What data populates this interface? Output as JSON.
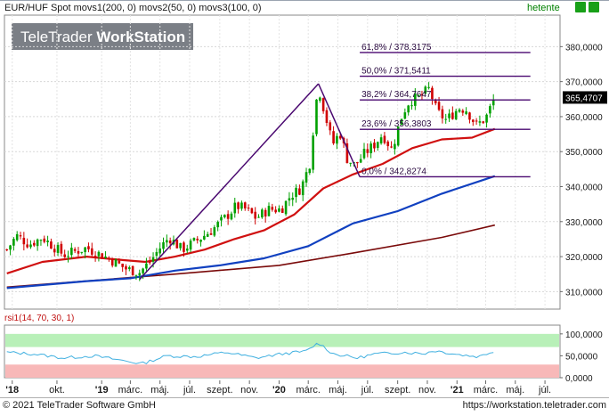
{
  "header": {
    "title": "EUR/HUF Spot movs1(200, 0) movs2(50, 0) movs3(100, 0)",
    "period": "hetente",
    "logo_light": "TeleTrader",
    "logo_bold": "WorkStation"
  },
  "footer": {
    "copyright": "© 2021 TeleTrader Software GmbH",
    "url": "https://workstation.teletrader.com"
  },
  "indicator": {
    "label": "rsi1(14, 70, 30, 1)"
  },
  "colors": {
    "price_up": "#00a000",
    "price_down": "#d00000",
    "ma200": "#7a0a0a",
    "ma50": "#d01010",
    "ma100": "#1040c0",
    "trendline": "#4a0870",
    "fib_line": "#4a0870",
    "rsi_line": "#40b0e0",
    "rsi_overbought_zone": "#b8f0b8",
    "rsi_oversold_zone": "#f8b8b8"
  },
  "chart_data": [
    {
      "type": "line",
      "title": "EUR/HUF Spot movs1(200, 0) movs2(50, 0) movs3(100, 0)",
      "frequency": "hetente",
      "ylim": [
        305000,
        389000
      ],
      "y_ticks": [
        310000,
        320000,
        330000,
        340000,
        350000,
        360000,
        370000,
        380000
      ],
      "y_tick_labels": [
        "310,0000",
        "320,0000",
        "330,0000",
        "340,0000",
        "350,0000",
        "360,0000",
        "370,0000",
        "380,0000"
      ],
      "x_axis": {
        "range": [
          "2018-06-15",
          "2021-08-01"
        ],
        "labels": [
          {
            "text": "'18",
            "date": "2018-07-01"
          },
          {
            "text": "okt.",
            "date": "2018-10-01"
          },
          {
            "text": "'19",
            "date": "2019-01-01"
          },
          {
            "text": "márc.",
            "date": "2019-03-01"
          },
          {
            "text": "máj.",
            "date": "2019-05-01"
          },
          {
            "text": "júl.",
            "date": "2019-07-01"
          },
          {
            "text": "szept.",
            "date": "2019-09-01"
          },
          {
            "text": "nov.",
            "date": "2019-11-01"
          },
          {
            "text": "'20",
            "date": "2020-01-01"
          },
          {
            "text": "márc.",
            "date": "2020-03-01"
          },
          {
            "text": "máj.",
            "date": "2020-05-01"
          },
          {
            "text": "júl.",
            "date": "2020-07-01"
          },
          {
            "text": "szept.",
            "date": "2020-09-01"
          },
          {
            "text": "nov.",
            "date": "2020-11-01"
          },
          {
            "text": "'21",
            "date": "2021-01-01"
          },
          {
            "text": "márc.",
            "date": "2021-03-01"
          },
          {
            "text": "máj.",
            "date": "2021-05-01"
          },
          {
            "text": "júl.",
            "date": "2021-07-01"
          }
        ]
      },
      "last_price": {
        "value": 365470.7,
        "label": "365,4707"
      },
      "price_anchors": [
        [
          "2018-06-20",
          322000
        ],
        [
          "2018-07-10",
          326000
        ],
        [
          "2018-08-05",
          323500
        ],
        [
          "2018-09-01",
          325500
        ],
        [
          "2018-10-15",
          320500
        ],
        [
          "2018-12-01",
          322500
        ],
        [
          "2019-01-15",
          319500
        ],
        [
          "2019-02-20",
          316500
        ],
        [
          "2019-03-20",
          315500
        ],
        [
          "2019-04-10",
          318500
        ],
        [
          "2019-05-01",
          322500
        ],
        [
          "2019-05-20",
          325500
        ],
        [
          "2019-06-15",
          322000
        ],
        [
          "2019-07-15",
          324500
        ],
        [
          "2019-08-15",
          327500
        ],
        [
          "2019-09-15",
          331500
        ],
        [
          "2019-10-05",
          334500
        ],
        [
          "2019-10-25",
          333500
        ],
        [
          "2019-11-15",
          331000
        ],
        [
          "2019-12-10",
          333500
        ],
        [
          "2020-01-05",
          333500
        ],
        [
          "2020-01-25",
          337500
        ],
        [
          "2020-02-15",
          339500
        ],
        [
          "2020-03-05",
          347000
        ],
        [
          "2020-03-15",
          362000
        ],
        [
          "2020-03-22",
          368500
        ],
        [
          "2020-04-05",
          360500
        ],
        [
          "2020-04-20",
          352000
        ],
        [
          "2020-05-05",
          355500
        ],
        [
          "2020-05-20",
          348000
        ],
        [
          "2020-06-05",
          346000
        ],
        [
          "2020-06-25",
          349500
        ],
        [
          "2020-07-15",
          352000
        ],
        [
          "2020-08-01",
          355000
        ],
        [
          "2020-08-20",
          350500
        ],
        [
          "2020-09-10",
          360500
        ],
        [
          "2020-09-25",
          364500
        ],
        [
          "2020-10-15",
          365500
        ],
        [
          "2020-11-05",
          368000
        ],
        [
          "2020-11-20",
          361500
        ],
        [
          "2020-12-10",
          359000
        ],
        [
          "2021-01-05",
          362500
        ],
        [
          "2021-01-20",
          362000
        ],
        [
          "2021-02-10",
          357500
        ],
        [
          "2021-03-01",
          359500
        ],
        [
          "2021-03-20",
          365470.7
        ]
      ],
      "series": [
        {
          "name": "movs1(200, 0)",
          "anchors": [
            [
              "2018-06-20",
              311300
            ],
            [
              "2019-06-01",
              315000
            ],
            [
              "2020-01-01",
              317500
            ],
            [
              "2020-06-01",
              321000
            ],
            [
              "2020-12-01",
              325500
            ],
            [
              "2021-03-20",
              329000
            ]
          ]
        },
        {
          "name": "movs2(50, 0)",
          "anchors": [
            [
              "2018-06-20",
              315200
            ],
            [
              "2018-09-01",
              318500
            ],
            [
              "2018-12-01",
              320000
            ],
            [
              "2019-02-15",
              319000
            ],
            [
              "2019-04-01",
              318500
            ],
            [
              "2019-06-01",
              320000
            ],
            [
              "2019-08-01",
              322000
            ],
            [
              "2019-10-01",
              325000
            ],
            [
              "2019-12-01",
              327500
            ],
            [
              "2020-02-01",
              332000
            ],
            [
              "2020-04-01",
              339500
            ],
            [
              "2020-06-01",
              343500
            ],
            [
              "2020-08-01",
              346500
            ],
            [
              "2020-10-01",
              351000
            ],
            [
              "2020-12-01",
              353500
            ],
            [
              "2021-02-01",
              354000
            ],
            [
              "2021-03-20",
              356500
            ]
          ]
        },
        {
          "name": "movs3(100, 0)",
          "anchors": [
            [
              "2018-06-20",
              311000
            ],
            [
              "2018-12-01",
              313000
            ],
            [
              "2019-03-01",
              313800
            ],
            [
              "2019-06-01",
              316000
            ],
            [
              "2019-09-01",
              317500
            ],
            [
              "2019-12-01",
              319500
            ],
            [
              "2020-03-01",
              323000
            ],
            [
              "2020-06-01",
              329500
            ],
            [
              "2020-09-01",
              333000
            ],
            [
              "2020-12-01",
              338000
            ],
            [
              "2021-03-20",
              343000
            ]
          ]
        }
      ],
      "trendlines": [
        {
          "from": [
            "2019-03-20",
            313500
          ],
          "to": [
            "2020-03-22",
            369400
          ]
        },
        {
          "from": [
            "2020-03-22",
            369400
          ],
          "to": [
            "2020-06-15",
            342800
          ]
        }
      ],
      "fibonacci": {
        "start_date": "2020-06-15",
        "end_date": "2021-06-01",
        "levels": [
          {
            "label": "61,8% / 378,3175",
            "value": 378317.5
          },
          {
            "label": "50,0% / 371,5411",
            "value": 371541.1
          },
          {
            "label": "38,2% / 364,7647",
            "value": 364764.7
          },
          {
            "label": "23,6% / 356,3803",
            "value": 356380.3
          },
          {
            "label": "0,0% / 342,8274",
            "value": 342827.4
          }
        ]
      }
    },
    {
      "type": "line",
      "title": "rsi1(14, 70, 30, 1)",
      "ylim": [
        0,
        120
      ],
      "y_ticks": [
        0,
        50,
        100
      ],
      "y_tick_labels": [
        "0,0000",
        "50,0000",
        "100,0000"
      ],
      "overbought": 70,
      "oversold": 30,
      "zones": [
        {
          "name": "overbought",
          "range": [
            70,
            100
          ]
        },
        {
          "name": "oversold",
          "range": [
            0,
            30
          ]
        }
      ],
      "anchors": [
        [
          "2018-06-20",
          58
        ],
        [
          "2018-08-15",
          54
        ],
        [
          "2018-10-15",
          45
        ],
        [
          "2018-12-15",
          50
        ],
        [
          "2019-02-20",
          38
        ],
        [
          "2019-03-25",
          32
        ],
        [
          "2019-05-15",
          50
        ],
        [
          "2019-07-15",
          48
        ],
        [
          "2019-09-15",
          58
        ],
        [
          "2019-11-15",
          45
        ],
        [
          "2020-01-10",
          55
        ],
        [
          "2020-02-25",
          60
        ],
        [
          "2020-03-22",
          80
        ],
        [
          "2020-04-20",
          55
        ],
        [
          "2020-06-10",
          45
        ],
        [
          "2020-07-15",
          54
        ],
        [
          "2020-09-15",
          58
        ],
        [
          "2020-10-25",
          55
        ],
        [
          "2020-11-15",
          62
        ],
        [
          "2021-01-10",
          52
        ],
        [
          "2021-02-15",
          48
        ],
        [
          "2021-03-20",
          62
        ]
      ]
    }
  ]
}
